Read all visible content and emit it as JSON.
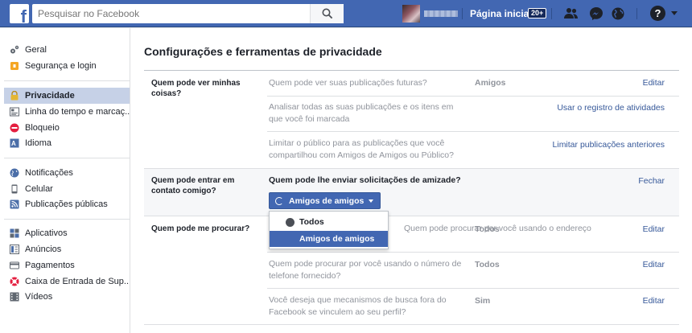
{
  "topbar": {
    "logo": "f",
    "search_placeholder": "Pesquisar no Facebook",
    "home_label": "Página inicial",
    "home_badge": "20+",
    "icons": [
      "search-icon",
      "friends-icon",
      "messenger-icon",
      "globe-icon",
      "help-icon",
      "caret-down-icon"
    ],
    "brand_color": "#4267b2"
  },
  "sidebar": {
    "items": [
      {
        "label": "Geral",
        "icon": "gear-icon"
      },
      {
        "label": "Segurança e login",
        "icon": "shield-icon"
      },
      {
        "label": "Privacidade",
        "icon": "lock-icon",
        "active": true
      },
      {
        "label": "Linha do tempo e marcaç...",
        "icon": "timeline-icon"
      },
      {
        "label": "Bloqueio",
        "icon": "block-icon"
      },
      {
        "label": "Idioma",
        "icon": "language-icon"
      },
      {
        "label": "Notificações",
        "icon": "globe-icon"
      },
      {
        "label": "Celular",
        "icon": "mobile-icon"
      },
      {
        "label": "Publicações públicas",
        "icon": "rss-icon"
      },
      {
        "label": "Aplicativos",
        "icon": "apps-icon"
      },
      {
        "label": "Anúncios",
        "icon": "ads-icon"
      },
      {
        "label": "Pagamentos",
        "icon": "payments-icon"
      },
      {
        "label": "Caixa de Entrada de Sup...",
        "icon": "support-icon"
      },
      {
        "label": "Vídeos",
        "icon": "video-icon"
      }
    ]
  },
  "main": {
    "title": "Configurações e ferramentas de privacidade",
    "sections": [
      {
        "label": "Quem pode ver minhas coisas?",
        "rows": [
          {
            "question": "Quem pode ver suas publicações futuras?",
            "value": "Amigos",
            "action": "Editar"
          },
          {
            "question": "Analisar todas as suas publicações e os itens em que você foi marcada",
            "value": "",
            "action": "Usar o registro de atividades"
          },
          {
            "question": "Limitar o público para as publicações que você compartilhou com Amigos de Amigos ou Público?",
            "value": "",
            "action": "Limitar publicações anteriores"
          }
        ]
      },
      {
        "label": "Quem pode entrar em contato comigo?",
        "expanded_question": "Quem pode lhe enviar solicitações de amizade?",
        "close_label": "Fechar",
        "selected": "Amigos de amigos",
        "options": [
          "Todos",
          "Amigos de amigos"
        ]
      },
      {
        "label": "Quem pode me procurar?",
        "rows": [
          {
            "question": "Quem pode procurar por você usando o endereço",
            "value": "Todos",
            "action": "Editar"
          },
          {
            "question": "Quem pode procurar por você usando o número de telefone fornecido?",
            "value": "Todos",
            "action": "Editar"
          },
          {
            "question": "Você deseja que mecanismos de busca fora do Facebook se vinculem ao seu perfil?",
            "value": "Sim",
            "action": "Editar"
          }
        ]
      }
    ]
  }
}
